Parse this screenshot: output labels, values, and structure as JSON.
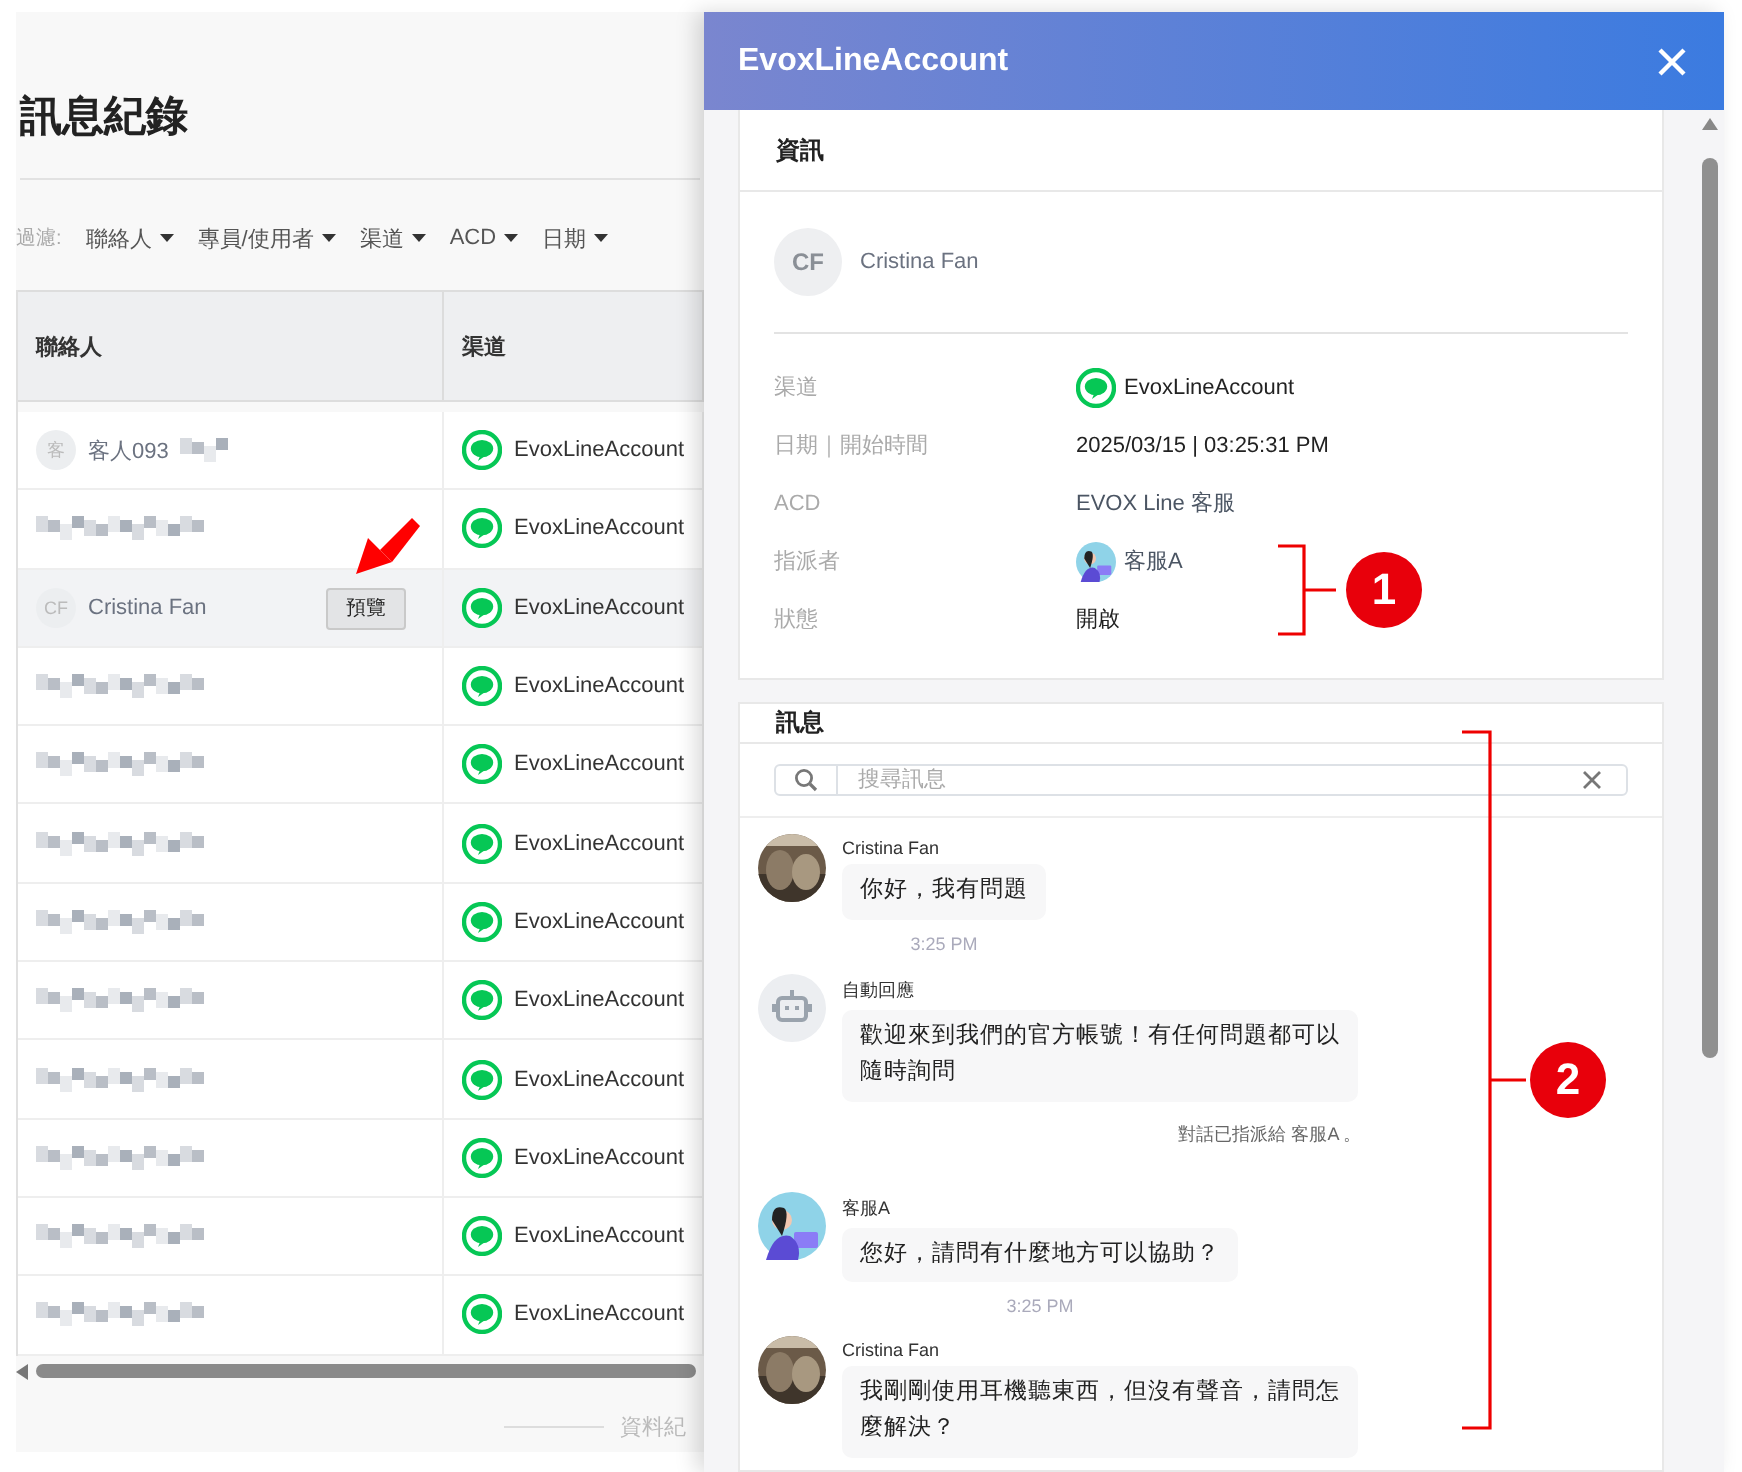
{
  "page": {
    "title": "訊息紀錄",
    "filter_label": "過濾:",
    "filters": [
      "聯絡人",
      "專員/使用者",
      "渠道",
      "ACD",
      "日期"
    ],
    "table": {
      "columns": [
        "聯絡人",
        "渠道"
      ],
      "rows": [
        {
          "kind": "named",
          "initials": "客",
          "name": "客人093",
          "blurred_tail": true,
          "selected": false,
          "channel": "EvoxLineAccount"
        },
        {
          "kind": "redacted",
          "selected": false,
          "channel": "EvoxLineAccount"
        },
        {
          "kind": "named",
          "initials": "CF",
          "name": "Cristina Fan",
          "blurred_tail": false,
          "selected": true,
          "action": "預覽",
          "channel": "EvoxLineAccount"
        },
        {
          "kind": "redacted",
          "selected": false,
          "channel": "EvoxLineAccount"
        },
        {
          "kind": "redacted",
          "selected": false,
          "channel": "EvoxLineAccount"
        },
        {
          "kind": "redacted",
          "selected": false,
          "channel": "EvoxLineAccount"
        },
        {
          "kind": "redacted",
          "selected": false,
          "channel": "EvoxLineAccount"
        },
        {
          "kind": "redacted",
          "selected": false,
          "channel": "EvoxLineAccount"
        },
        {
          "kind": "redacted",
          "selected": false,
          "channel": "EvoxLineAccount"
        },
        {
          "kind": "redacted",
          "selected": false,
          "channel": "EvoxLineAccount"
        },
        {
          "kind": "redacted",
          "selected": false,
          "channel": "EvoxLineAccount"
        },
        {
          "kind": "redacted",
          "selected": false,
          "channel": "EvoxLineAccount"
        }
      ]
    },
    "footer": "資料紀"
  },
  "panel": {
    "title": "EvoxLineAccount",
    "info": {
      "title": "資訊",
      "initials": "CF",
      "name": "Cristina Fan",
      "fields": [
        {
          "label": "渠道",
          "kind": "channel",
          "value": "EvoxLineAccount"
        },
        {
          "label": "日期｜開始時間",
          "kind": "text",
          "value": "2025/03/15 | 03:25:31 PM"
        },
        {
          "label": "ACD",
          "kind": "link",
          "value": "EVOX Line 客服"
        },
        {
          "label": "指派者",
          "kind": "agent",
          "value": "客服A"
        },
        {
          "label": "狀態",
          "kind": "text",
          "value": "開啟"
        }
      ]
    },
    "messages": {
      "title": "訊息",
      "search_placeholder": "搜尋訊息",
      "items": [
        {
          "kind": "message",
          "sender": "Cristina Fan",
          "text": "你好，我有問題",
          "time": "3:25 PM"
        },
        {
          "kind": "message",
          "avatar": {
            "kind": "bot"
          },
          "sender": "自動回應",
          "text": "歡迎來到我們的官方帳號！有任何問題都可以隨時詢問"
        },
        {
          "kind": "system",
          "text": "對話已指派給 客服A 。"
        },
        {
          "kind": "message",
          "avatar": {
            "kind": "agent"
          },
          "sender": "客服A",
          "text": "您好，請問有什麼地方可以協助？",
          "time": "3:25 PM"
        },
        {
          "kind": "message",
          "sender": "Cristina Fan",
          "text": "我剛剛使用耳機聽東西，但沒有聲音，請問怎麼解決？"
        }
      ]
    }
  },
  "annotations": [
    "1",
    "2"
  ]
}
